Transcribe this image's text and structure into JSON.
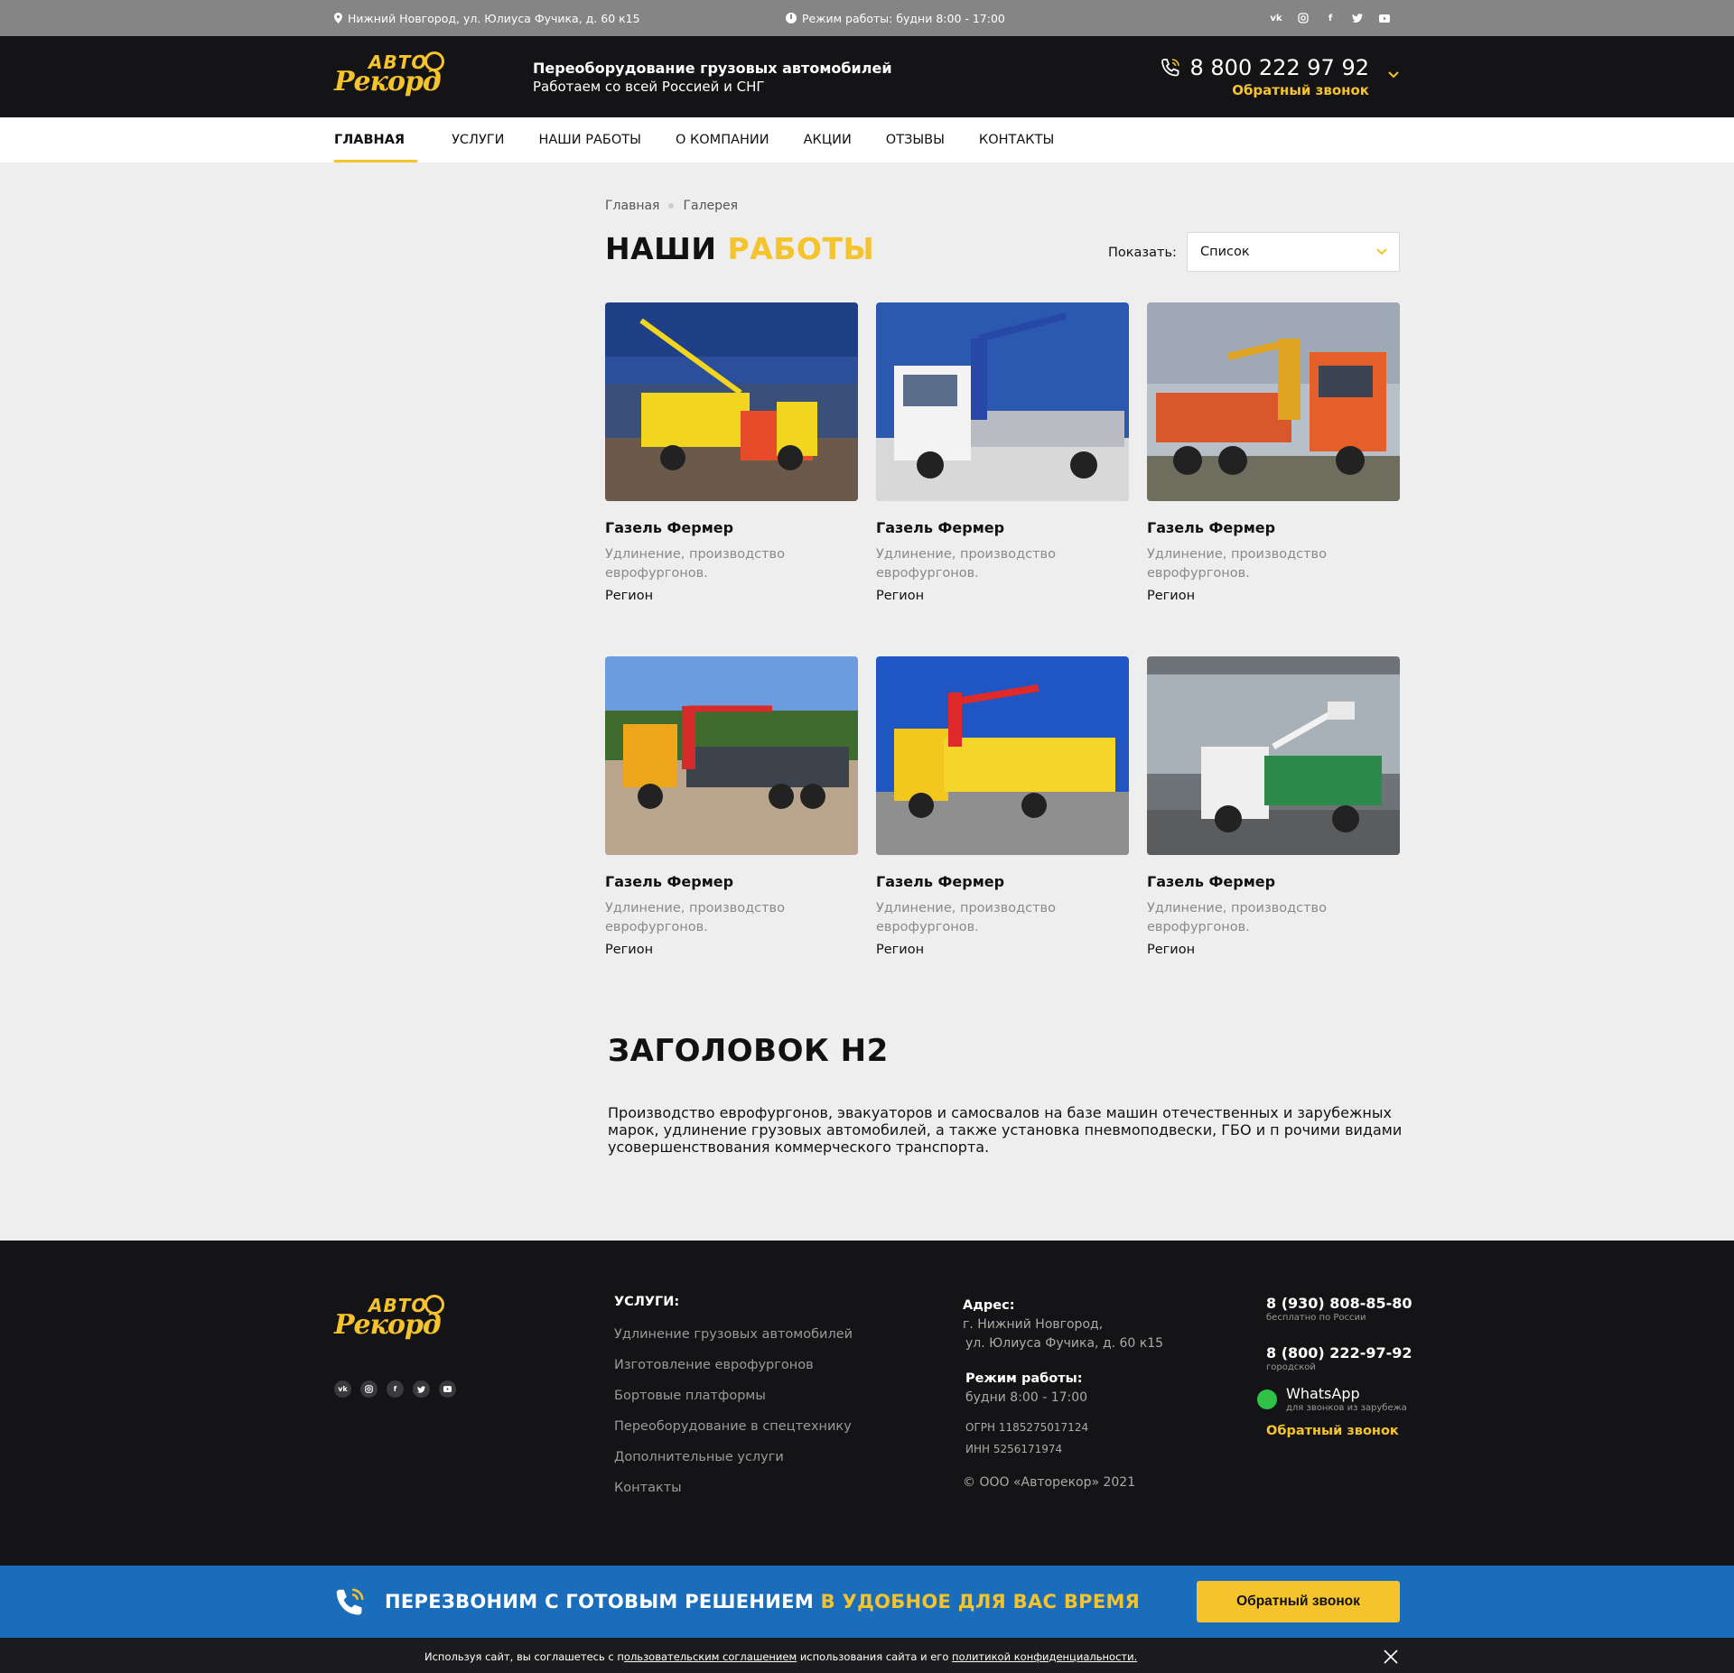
{
  "topbar": {
    "address": "Нижний Новгород, ул. Юлиуса Фучика, д. 60 к15",
    "hours": "Режим работы: будни 8:00 - 17:00",
    "socials": [
      "vk-icon",
      "instagram-icon",
      "facebook-icon",
      "twitter-icon",
      "youtube-icon"
    ]
  },
  "header": {
    "logo_top": "АВТО",
    "logo_bottom": "Рекорд",
    "tagline_1": "Переоборудование грузовых автомобилей",
    "tagline_2": "Работаем со всей Россией и СНГ",
    "phone": "8 800 222 97 92",
    "callback": "Обратный звонок"
  },
  "nav": {
    "items": [
      {
        "label": "ГЛАВНАЯ",
        "active": true
      },
      {
        "label": "УСЛУГИ"
      },
      {
        "label": "НАШИ РАБОТЫ"
      },
      {
        "label": "О КОМПАНИИ"
      },
      {
        "label": "АКЦИИ"
      },
      {
        "label": "ОТЗЫВЫ"
      },
      {
        "label": "КОНТАКТЫ"
      }
    ]
  },
  "breadcrumb": {
    "home": "Главная",
    "current": "Галерея"
  },
  "page": {
    "title_1": "НАШИ",
    "title_2": "РАБОТЫ",
    "show_label": "Показать:",
    "select_value": "Список"
  },
  "cards": [
    {
      "title": "Газель Фермер",
      "desc": "Удлинение, производство еврофургонов.",
      "region": "Регион"
    },
    {
      "title": "Газель Фермер",
      "desc": "Удлинение, производство еврофургонов.",
      "region": "Регион"
    },
    {
      "title": "Газель Фермер",
      "desc": "Удлинение, производство еврофургонов.",
      "region": "Регион"
    },
    {
      "title": "Газель Фермер",
      "desc": "Удлинение, производство еврофургонов.",
      "region": "Регион"
    },
    {
      "title": "Газель Фермер",
      "desc": "Удлинение, производство еврофургонов.",
      "region": "Регион"
    },
    {
      "title": "Газель Фермер",
      "desc": "Удлинение, производство еврофургонов.",
      "region": "Регион"
    }
  ],
  "seo": {
    "heading": "ЗАГОЛОВОК H2",
    "text": "Производство еврофургонов, эвакуаторов и самосвалов на базе машин отечественных и зарубежных марок, удлинение грузовых автомобилей, а также установка пневмоподвески, ГБО и п рочими видами усовершенствования коммерческого транспорта."
  },
  "footer": {
    "services_heading": "УСЛУГИ:",
    "services": [
      "Удлинение грузовых автомобилей",
      "Изготовление еврофургонов",
      "Бортовые платформы",
      "Переоборудование в спецтехнику",
      "Дополнительные услуги",
      "Контакты"
    ],
    "address_heading": "Адрес:",
    "address_1": "г. Нижний Новгород,",
    "address_2": "ул. Юлиуса Фучика, д. 60 к15",
    "hours_heading": "Режим работы:",
    "hours": "будни  8:00 - 17:00",
    "ogrn": "ОГРН 1185275017124",
    "inn": "ИНН 5256171974",
    "copyright": "© ООО «Авторекор» 2021",
    "phone_1": "8 (930) 808-85-80",
    "phone_1_sub": "бесплатно по России",
    "phone_2": "8 (800) 222-97-92",
    "phone_2_sub": "городской",
    "whatsapp": "WhatsApp",
    "whatsapp_sub": "для звонков из зарубежа",
    "callback": "Обратный звонок"
  },
  "banner": {
    "text_1": "ПЕРЕЗВОНИМ С ГОТОВЫМ РЕШЕНИЕМ",
    "text_2": "В УДОБНОЕ ДЛЯ ВАС ВРЕМЯ",
    "button": "Обратный звонок"
  },
  "cookie": {
    "text_1": "Используя  сайт, вы соглашетесь с п",
    "link_1": "ользовательским соглашением",
    "text_2": " использования сайта и его ",
    "link_2": "политикой конфиденциальности."
  },
  "colors": {
    "accent": "#f5c32c",
    "dark": "#141416",
    "banner": "#1a6dba"
  }
}
